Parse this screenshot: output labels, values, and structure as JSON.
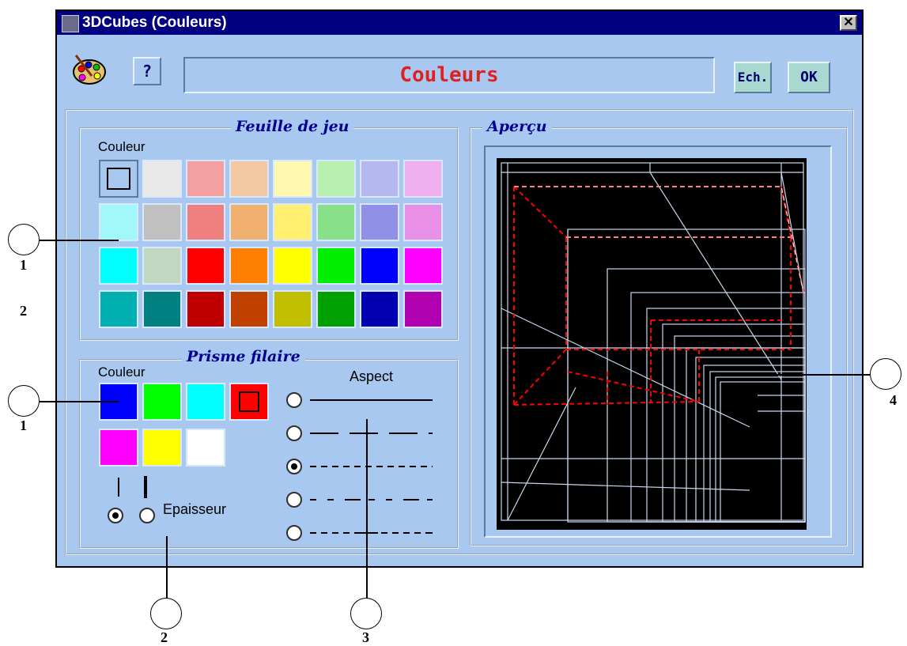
{
  "window": {
    "title": "3DCubes (Couleurs)",
    "close_glyph": "✕"
  },
  "toolbar": {
    "help_label": "?",
    "heading": "Couleurs",
    "heading_color": "#e02020",
    "exchange_label": "Ech.",
    "ok_label": "OK",
    "palette_icon": "palette-icon"
  },
  "game_sheet": {
    "legend": "Feuille de jeu",
    "color_label": "Couleur",
    "swatches": [
      [
        "#a8c8f0",
        "#e8e8e8",
        "#f4a0a0",
        "#f4c8a0",
        "#fff8b0",
        "#b8f0b0",
        "#b8b8f0",
        "#f0b0f0"
      ],
      [
        "#a0f8f8",
        "#c0c0c0",
        "#f08080",
        "#f0b070",
        "#fff070",
        "#88e088",
        "#9090e8",
        "#e890e8"
      ],
      [
        "#00ffff",
        "#c0d8c0",
        "#ff0000",
        "#ff8000",
        "#ffff00",
        "#00ee00",
        "#0000ff",
        "#ff00ff"
      ],
      [
        "#00b0b0",
        "#008080",
        "#c00000",
        "#c04000",
        "#c0c000",
        "#00a000",
        "#0000b0",
        "#b000b0"
      ]
    ],
    "selected_index": 0
  },
  "wire_prism": {
    "legend": "Prisme filaire",
    "color_label": "Couleur",
    "swatches": [
      "#0000ff",
      "#00ff00",
      "#00ffff",
      "#ff0000",
      "#ff00ff",
      "#ffff00",
      "#ffffff"
    ],
    "selected_index": 3,
    "thickness_label": "Epaisseur",
    "thickness_selected": 0,
    "aspect_label": "Aspect",
    "aspect_options": [
      "solid",
      "long-dash",
      "dashed",
      "dash-dot",
      "dash-long"
    ],
    "aspect_selected": 2
  },
  "preview": {
    "legend": "Aperçu"
  },
  "callouts": {
    "c1a": "1",
    "c2a": "2",
    "c1b": "1",
    "c2b": "2",
    "c3": "3",
    "c4": "4"
  }
}
